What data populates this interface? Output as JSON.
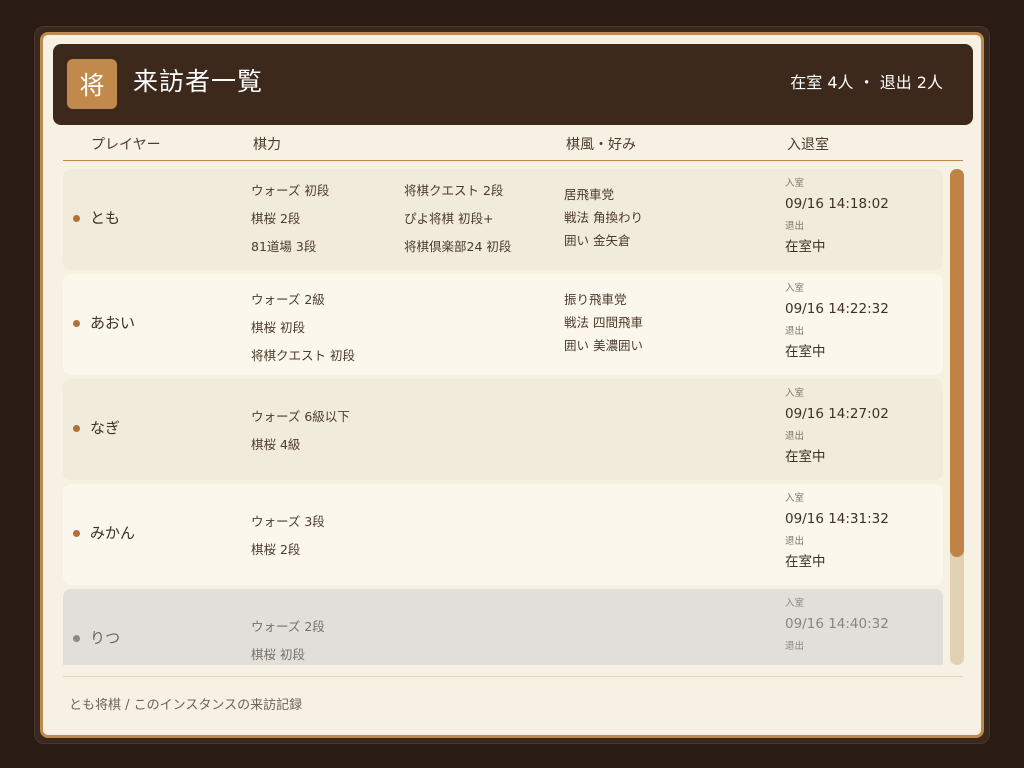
{
  "header": {
    "logo_char": "将",
    "title": "来訪者一覧",
    "status": "在室 4人 ・ 退出 2人"
  },
  "columns": {
    "player": "プレイヤー",
    "rating": "棋力",
    "style": "棋風・好み",
    "inout": "入退室"
  },
  "labels": {
    "in": "入室",
    "out": "退出"
  },
  "rows": [
    {
      "name": "とも",
      "ratings": [
        "ウォーズ 初段",
        "棋桜 2段",
        "81道場 3段",
        "将棋クエスト 2段",
        "ぴよ将棋 初段+",
        "将棋倶楽部24 初段"
      ],
      "styles": [
        "居飛車党",
        "戦法 角換わり",
        "囲い 金矢倉"
      ],
      "in_time": "09/16 14:18:02",
      "out_value": "在室中"
    },
    {
      "name": "あおい",
      "ratings": [
        "ウォーズ 2級",
        "棋桜 初段",
        "将棋クエスト 初段"
      ],
      "styles": [
        "振り飛車党",
        "戦法 四間飛車",
        "囲い 美濃囲い"
      ],
      "in_time": "09/16 14:22:32",
      "out_value": "在室中"
    },
    {
      "name": "なぎ",
      "ratings": [
        "ウォーズ 6級以下",
        "棋桜 4級"
      ],
      "styles": [],
      "in_time": "09/16 14:27:02",
      "out_value": "在室中"
    },
    {
      "name": "みかん",
      "ratings": [
        "ウォーズ 3段",
        "棋桜 2段"
      ],
      "styles": [],
      "in_time": "09/16 14:31:32",
      "out_value": "在室中"
    },
    {
      "name": "りつ",
      "ratings": [
        "ウォーズ 2段",
        "棋桜 初段"
      ],
      "styles": [],
      "in_time": "09/16 14:40:32",
      "out_value": ""
    }
  ],
  "footer": {
    "text": "とも将棋 / このインスタンスの来訪記録"
  },
  "colors": {
    "accent": "#c18a4c",
    "header_bg": "#3d281c",
    "present_dot": "#b0703a",
    "absent_dot": "#8d8a86"
  }
}
